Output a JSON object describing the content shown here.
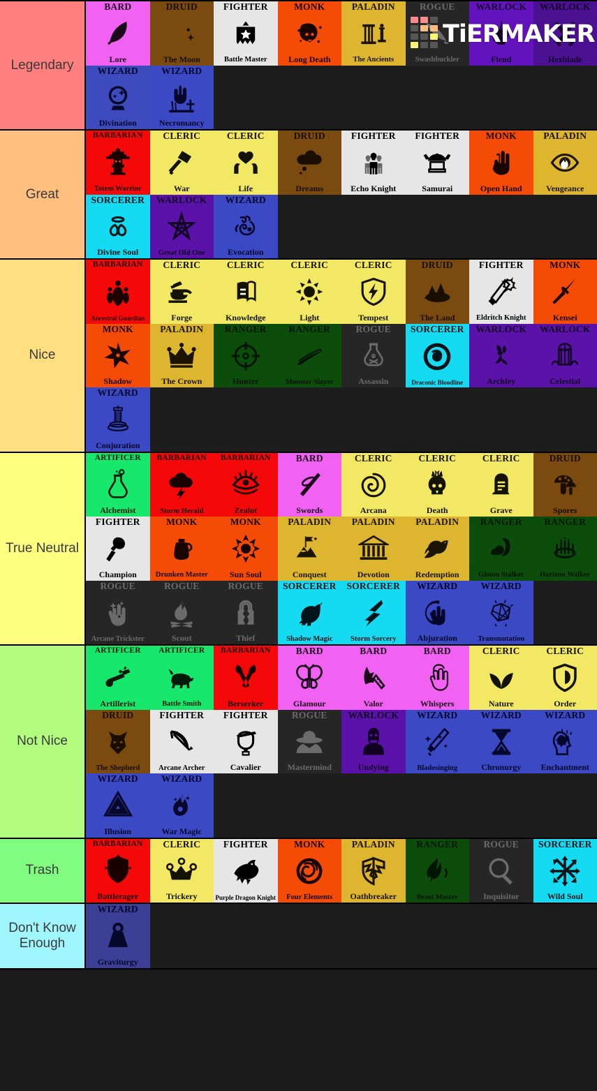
{
  "watermark": {
    "text": "TiERMAKER",
    "grid_colors": [
      "#f98b8b",
      "#f98b8b",
      "#565656",
      "#565656",
      "#f9bd84",
      "#f9bd84",
      "#565656",
      "#565656",
      "#f7f579",
      "#f7f579",
      "#565656",
      "#565656",
      "#7ff07f",
      "#7ff07f",
      "#565656",
      "#565656"
    ]
  },
  "tiers": [
    {
      "label": "Legendary",
      "color": "#ff7f7f",
      "items": [
        {
          "cls": "BARD",
          "sub": "Lore",
          "bg": "#f262f2",
          "fg": "#1a0a1a",
          "icon": "quill-feather-icon"
        },
        {
          "cls": "DRUID",
          "sub": "The Moon",
          "bg": "#7a4a0e",
          "fg": "#1a0e00",
          "icon": "crescent-moon-icon"
        },
        {
          "cls": "FIGHTER",
          "sub": "Battle Master",
          "bg": "#e6e6e6",
          "fg": "#000000",
          "icon": "banner-star-icon"
        },
        {
          "cls": "MONK",
          "sub": "Long Death",
          "bg": "#f44b06",
          "fg": "#190500",
          "icon": "skull-blot-icon"
        },
        {
          "cls": "PALADIN",
          "sub": "The Ancients",
          "bg": "#ddb52e",
          "fg": "#1a1400",
          "icon": "pillars-icon"
        },
        {
          "cls": "ROGUE",
          "sub": "Swashbuckler",
          "bg": "#262626",
          "fg": "#6b6b6b",
          "icon": "cutlass-icon"
        },
        {
          "cls": "WARLOCK",
          "sub": "Fiend",
          "bg": "#6313bd",
          "fg": "#120024",
          "icon": "devil-flame-icon"
        },
        {
          "cls": "WARLOCK",
          "sub": "Hexblade",
          "bg": "#4b1192",
          "fg": "#120024",
          "icon": "crossed-blades-icon"
        },
        {
          "cls": "WIZARD",
          "sub": "Divination",
          "bg": "#3e4bbf",
          "fg": "#05082a",
          "icon": "crystal-ball-icon"
        },
        {
          "cls": "WIZARD",
          "sub": "Necromancy",
          "bg": "#3b49c4",
          "fg": "#05082a",
          "icon": "grave-hand-icon"
        }
      ]
    },
    {
      "label": "Great",
      "color": "#ffbf7f",
      "items": [
        {
          "cls": "BARBARIAN",
          "sub": "Totem Warrior",
          "bg": "#f50808",
          "fg": "#1a0000",
          "icon": "totem-pole-icon"
        },
        {
          "cls": "CLERIC",
          "sub": "War",
          "bg": "#f2e863",
          "fg": "#141200",
          "icon": "war-hammer-icon"
        },
        {
          "cls": "CLERIC",
          "sub": "Life",
          "bg": "#f2e863",
          "fg": "#141200",
          "icon": "heart-hands-icon"
        },
        {
          "cls": "DRUID",
          "sub": "Dreams",
          "bg": "#7a4a0e",
          "fg": "#1a0e00",
          "icon": "thought-cloud-icon"
        },
        {
          "cls": "FIGHTER",
          "sub": "Echo Knight",
          "bg": "#e6e6e6",
          "fg": "#000000",
          "icon": "echo-figures-icon"
        },
        {
          "cls": "FIGHTER",
          "sub": "Samurai",
          "bg": "#e6e6e6",
          "fg": "#000000",
          "icon": "samurai-helmet-icon"
        },
        {
          "cls": "MONK",
          "sub": "Open Hand",
          "bg": "#f44b06",
          "fg": "#190500",
          "icon": "open-palm-icon"
        },
        {
          "cls": "PALADIN",
          "sub": "Vengeance",
          "bg": "#ddb52e",
          "fg": "#1a1400",
          "icon": "flaming-eye-icon"
        },
        {
          "cls": "SORCERER",
          "sub": "Divine Soul",
          "bg": "#14dbf2",
          "fg": "#00141a",
          "icon": "halo-wings-icon"
        },
        {
          "cls": "WARLOCK",
          "sub": "Great Old One",
          "bg": "#5b12a8",
          "fg": "#120024",
          "icon": "eldritch-star-icon"
        },
        {
          "cls": "WIZARD",
          "sub": "Evocation",
          "bg": "#3b49c4",
          "fg": "#05082a",
          "icon": "evocation-swirl-icon"
        }
      ]
    },
    {
      "label": "Nice",
      "color": "#ffdf80",
      "items": [
        {
          "cls": "BARBARIAN",
          "sub": "Ancestral Guardian",
          "bg": "#f50808",
          "fg": "#1a0000",
          "icon": "ancestors-icon"
        },
        {
          "cls": "CLERIC",
          "sub": "Forge",
          "bg": "#f2e863",
          "fg": "#141200",
          "icon": "anvil-hammer-icon"
        },
        {
          "cls": "CLERIC",
          "sub": "Knowledge",
          "bg": "#f2e863",
          "fg": "#141200",
          "icon": "book-icon"
        },
        {
          "cls": "CLERIC",
          "sub": "Light",
          "bg": "#f2e863",
          "fg": "#141200",
          "icon": "sun-rays-icon"
        },
        {
          "cls": "CLERIC",
          "sub": "Tempest",
          "bg": "#f2e863",
          "fg": "#141200",
          "icon": "lightning-shield-icon"
        },
        {
          "cls": "DRUID",
          "sub": "The Land",
          "bg": "#7a4a0e",
          "fg": "#1a0e00",
          "icon": "land-trees-icon"
        },
        {
          "cls": "FIGHTER",
          "sub": "Eldritch Knight",
          "bg": "#e6e6e6",
          "fg": "#000000",
          "icon": "magic-sword-icon"
        },
        {
          "cls": "MONK",
          "sub": "Kensei",
          "bg": "#f44b06",
          "fg": "#190500",
          "icon": "spear-icon"
        },
        {
          "cls": "MONK",
          "sub": "Shadow",
          "bg": "#f44b06",
          "fg": "#190500",
          "icon": "shuriken-icon"
        },
        {
          "cls": "PALADIN",
          "sub": "The Crown",
          "bg": "#ddb52e",
          "fg": "#1a1400",
          "icon": "crown-icon"
        },
        {
          "cls": "RANGER",
          "sub": "Hunter",
          "bg": "#0c4d0c",
          "fg": "#021402",
          "icon": "crosshair-icon"
        },
        {
          "cls": "RANGER",
          "sub": "Monster Slayer",
          "bg": "#0c4d0c",
          "fg": "#021402",
          "icon": "crossbow-icon"
        },
        {
          "cls": "ROGUE",
          "sub": "Assassin",
          "bg": "#262626",
          "fg": "#6b6b6b",
          "icon": "poison-flask-icon"
        },
        {
          "cls": "SORCERER",
          "sub": "Draconic Bloodline",
          "bg": "#14dbf2",
          "fg": "#00141a",
          "icon": "dragon-circle-icon"
        },
        {
          "cls": "WARLOCK",
          "sub": "Archfey",
          "bg": "#5b12a8",
          "fg": "#120024",
          "icon": "fairy-icon"
        },
        {
          "cls": "WARLOCK",
          "sub": "Celestial",
          "bg": "#5b12a8",
          "fg": "#120024",
          "icon": "celestial-gate-icon"
        },
        {
          "cls": "WIZARD",
          "sub": "Conjuration",
          "bg": "#3b49c4",
          "fg": "#05082a",
          "icon": "summoning-circle-icon"
        }
      ]
    },
    {
      "label": "True Neutral",
      "color": "#fdfd80",
      "items": [
        {
          "cls": "ARTIFICER",
          "sub": "Alchemist",
          "bg": "#17e86b",
          "fg": "#001a0a",
          "icon": "alchemy-flask-icon"
        },
        {
          "cls": "BARBARIAN",
          "sub": "Storm Herald",
          "bg": "#f50808",
          "fg": "#1a0000",
          "icon": "storm-cloud-icon"
        },
        {
          "cls": "BARBARIAN",
          "sub": "Zealot",
          "bg": "#f50808",
          "fg": "#1a0000",
          "icon": "zealot-eye-icon"
        },
        {
          "cls": "BARD",
          "sub": "Swords",
          "bg": "#f262f2",
          "fg": "#1a0a1a",
          "icon": "sword-disc-icon"
        },
        {
          "cls": "CLERIC",
          "sub": "Arcana",
          "bg": "#f2e863",
          "fg": "#141200",
          "icon": "spiral-icon"
        },
        {
          "cls": "CLERIC",
          "sub": "Death",
          "bg": "#f2e863",
          "fg": "#141200",
          "icon": "flaming-skull-icon"
        },
        {
          "cls": "CLERIC",
          "sub": "Grave",
          "bg": "#f2e863",
          "fg": "#141200",
          "icon": "tombstone-icon"
        },
        {
          "cls": "DRUID",
          "sub": "Spores",
          "bg": "#7a4a0e",
          "fg": "#1a0e00",
          "icon": "mushrooms-icon"
        },
        {
          "cls": "FIGHTER",
          "sub": "Champion",
          "bg": "#e6e6e6",
          "fg": "#000000",
          "icon": "trophy-axe-icon"
        },
        {
          "cls": "MONK",
          "sub": "Drunken Master",
          "bg": "#f44b06",
          "fg": "#190500",
          "icon": "jug-icon"
        },
        {
          "cls": "MONK",
          "sub": "Sun Soul",
          "bg": "#f44b06",
          "fg": "#190500",
          "icon": "sun-burst-icon"
        },
        {
          "cls": "PALADIN",
          "sub": "Conquest",
          "bg": "#ddb52e",
          "fg": "#1a1400",
          "icon": "flag-mountain-icon"
        },
        {
          "cls": "PALADIN",
          "sub": "Devotion",
          "bg": "#ddb52e",
          "fg": "#1a1400",
          "icon": "temple-icon"
        },
        {
          "cls": "PALADIN",
          "sub": "Redemption",
          "bg": "#ddb52e",
          "fg": "#1a1400",
          "icon": "dove-icon"
        },
        {
          "cls": "RANGER",
          "sub": "Gloom Stalker",
          "bg": "#0c4d0c",
          "fg": "#021402",
          "icon": "hood-cloud-icon"
        },
        {
          "cls": "RANGER",
          "sub": "Horizon Walker",
          "bg": "#0c4d0c",
          "fg": "#021402",
          "icon": "portal-icon"
        },
        {
          "cls": "ROGUE",
          "sub": "Arcane Trickster",
          "bg": "#262626",
          "fg": "#6b6b6b",
          "icon": "magic-hand-icon"
        },
        {
          "cls": "ROGUE",
          "sub": "Scout",
          "bg": "#262626",
          "fg": "#6b6b6b",
          "icon": "campfire-icon"
        },
        {
          "cls": "ROGUE",
          "sub": "Thief",
          "bg": "#262626",
          "fg": "#6b6b6b",
          "icon": "broken-lock-icon"
        },
        {
          "cls": "SORCERER",
          "sub": "Shadow Magic",
          "bg": "#14dbf2",
          "fg": "#00141a",
          "icon": "raven-icon"
        },
        {
          "cls": "SORCERER",
          "sub": "Storm Sorcery",
          "bg": "#14dbf2",
          "fg": "#00141a",
          "icon": "lightning-bolt-icon"
        },
        {
          "cls": "WIZARD",
          "sub": "Abjuration",
          "bg": "#3b49c4",
          "fg": "#05082a",
          "icon": "warding-hand-icon"
        },
        {
          "cls": "WIZARD",
          "sub": "Transmutation",
          "bg": "#3b49c4",
          "fg": "#05082a",
          "icon": "polyhedron-icon"
        }
      ]
    },
    {
      "label": "Not Nice",
      "color": "#b2fd80",
      "items": [
        {
          "cls": "ARTIFICER",
          "sub": "Artillerist",
          "bg": "#17e86b",
          "fg": "#001a0a",
          "icon": "cannon-icon"
        },
        {
          "cls": "ARTIFICER",
          "sub": "Battle Smith",
          "bg": "#17e86b",
          "fg": "#001a0a",
          "icon": "mechanical-dog-icon"
        },
        {
          "cls": "BARBARIAN",
          "sub": "Berserker",
          "bg": "#f50808",
          "fg": "#1a0000",
          "icon": "crossed-axes-icon"
        },
        {
          "cls": "BARD",
          "sub": "Glamour",
          "bg": "#f262f2",
          "fg": "#1a0a1a",
          "icon": "butterfly-icon"
        },
        {
          "cls": "BARD",
          "sub": "Valor",
          "bg": "#f262f2",
          "fg": "#1a0a1a",
          "icon": "horn-icon"
        },
        {
          "cls": "BARD",
          "sub": "Whispers",
          "bg": "#f262f2",
          "fg": "#1a0a1a",
          "icon": "whisper-hand-icon"
        },
        {
          "cls": "CLERIC",
          "sub": "Nature",
          "bg": "#f2e863",
          "fg": "#141200",
          "icon": "leaves-icon"
        },
        {
          "cls": "CLERIC",
          "sub": "Order",
          "bg": "#f2e863",
          "fg": "#141200",
          "icon": "order-shield-icon"
        },
        {
          "cls": "DRUID",
          "sub": "The Shepherd",
          "bg": "#7a4a0e",
          "fg": "#1a0e00",
          "icon": "wolf-head-icon"
        },
        {
          "cls": "FIGHTER",
          "sub": "Arcane Archer",
          "bg": "#e6e6e6",
          "fg": "#000000",
          "icon": "bow-arrow-icon"
        },
        {
          "cls": "FIGHTER",
          "sub": "Cavalier",
          "bg": "#e6e6e6",
          "fg": "#000000",
          "icon": "saddle-icon"
        },
        {
          "cls": "ROGUE",
          "sub": "Mastermind",
          "bg": "#262626",
          "fg": "#6b6b6b",
          "icon": "fedora-spy-icon"
        },
        {
          "cls": "WARLOCK",
          "sub": "Undying",
          "bg": "#5b12a8",
          "fg": "#120024",
          "icon": "zombie-icon"
        },
        {
          "cls": "WIZARD",
          "sub": "Bladesinging",
          "bg": "#3b49c4",
          "fg": "#05082a",
          "icon": "sparkle-sword-icon"
        },
        {
          "cls": "WIZARD",
          "sub": "Chronurgy",
          "bg": "#3b49c4",
          "fg": "#05082a",
          "icon": "hourglass-icon"
        },
        {
          "cls": "WIZARD",
          "sub": "Enchantment",
          "bg": "#3b49c4",
          "fg": "#05082a",
          "icon": "brain-head-icon"
        },
        {
          "cls": "WIZARD",
          "sub": "Illusion",
          "bg": "#3b49c4",
          "fg": "#05082a",
          "icon": "penrose-triangle-icon"
        },
        {
          "cls": "WIZARD",
          "sub": "War Magic",
          "bg": "#3b49c4",
          "fg": "#05082a",
          "icon": "magic-flame-icon"
        }
      ]
    },
    {
      "label": "Trash",
      "color": "#80fd80",
      "items": [
        {
          "cls": "BARBARIAN",
          "sub": "Battlerager",
          "bg": "#f50808",
          "fg": "#1a0000",
          "icon": "spiked-shield-icon"
        },
        {
          "cls": "CLERIC",
          "sub": "Trickery",
          "bg": "#f2e863",
          "fg": "#141200",
          "icon": "jester-crown-icon"
        },
        {
          "cls": "FIGHTER",
          "sub": "Purple Dragon Knight",
          "bg": "#e6e6e6",
          "fg": "#000000",
          "icon": "dragon-head-icon"
        },
        {
          "cls": "MONK",
          "sub": "Four Elements",
          "bg": "#f44b06",
          "fg": "#190500",
          "icon": "elements-swirl-icon"
        },
        {
          "cls": "PALADIN",
          "sub": "Oathbreaker",
          "bg": "#ddb52e",
          "fg": "#1a1400",
          "icon": "broken-shield-icon"
        },
        {
          "cls": "RANGER",
          "sub": "Beast Master",
          "bg": "#0c4d0c",
          "fg": "#021402",
          "icon": "beast-claw-icon"
        },
        {
          "cls": "ROGUE",
          "sub": "Inquisitor",
          "bg": "#262626",
          "fg": "#6b6b6b",
          "icon": "magnifier-icon"
        },
        {
          "cls": "SORCERER",
          "sub": "Wild Soul",
          "bg": "#14dbf2",
          "fg": "#00141a",
          "icon": "chaos-arrows-icon"
        }
      ]
    },
    {
      "label": "Don't Know Enough",
      "color": "#9ff7fd",
      "items": [
        {
          "cls": "WIZARD",
          "sub": "Graviturgy",
          "bg": "#3b3f96",
          "fg": "#05082a",
          "icon": "weight-icon"
        }
      ]
    }
  ]
}
